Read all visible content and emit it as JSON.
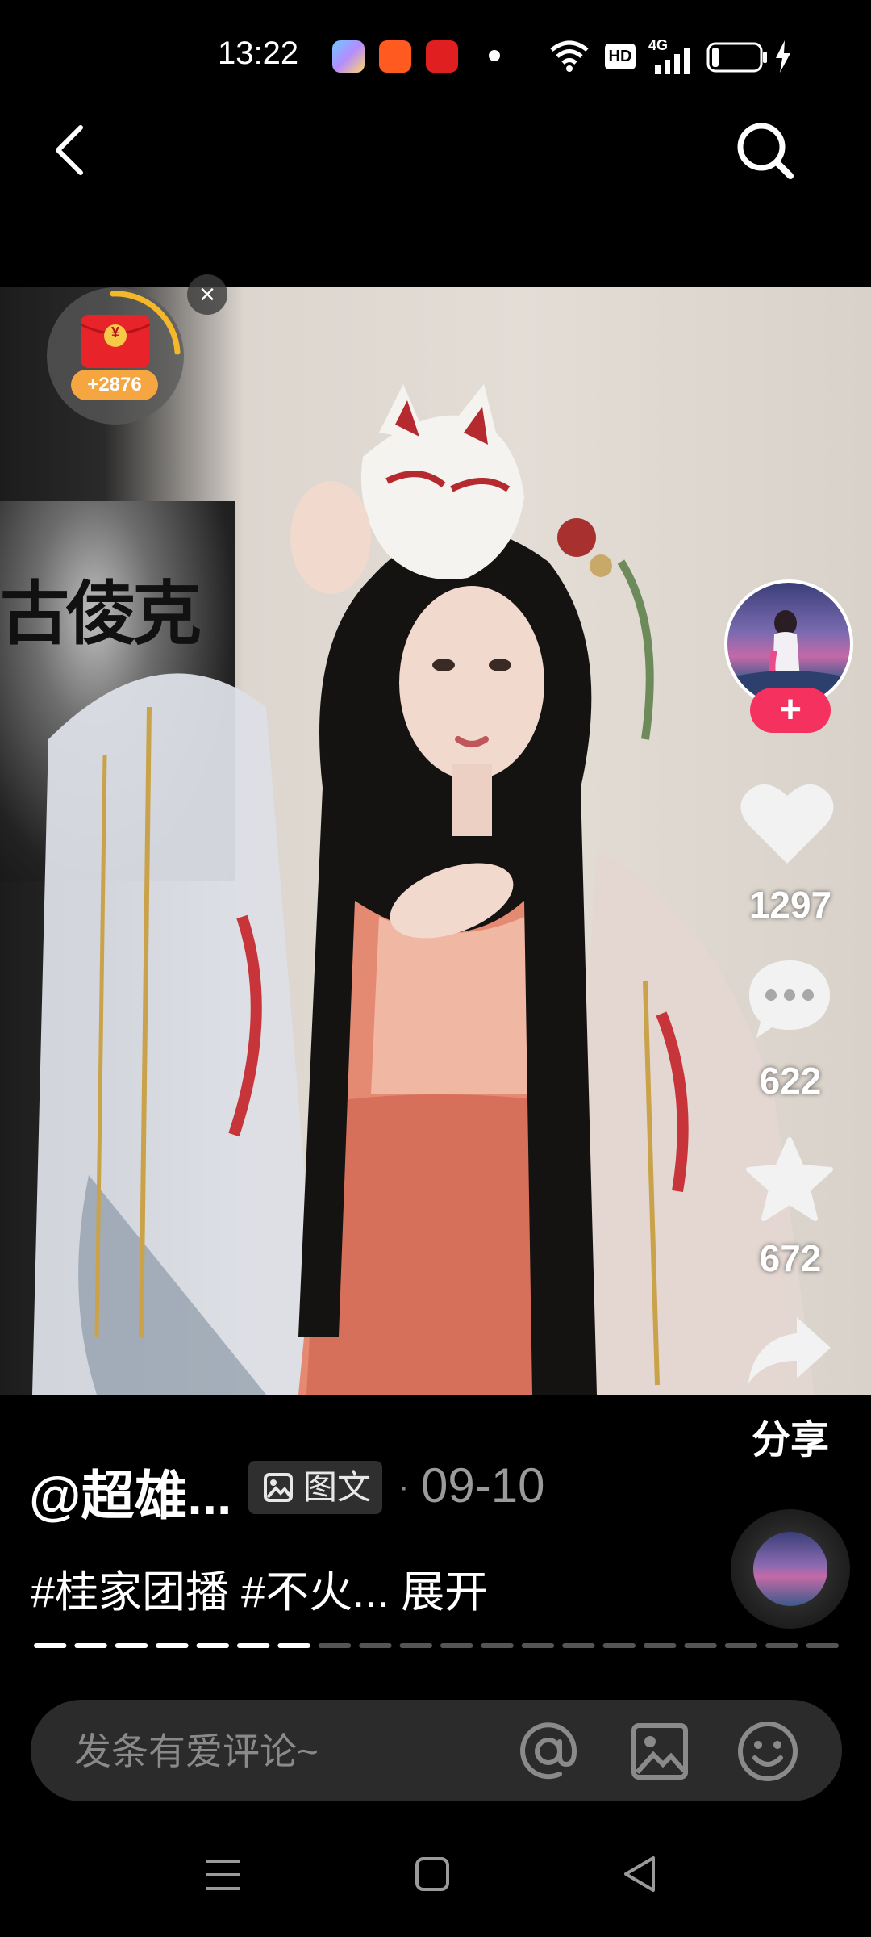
{
  "status_bar": {
    "time": "13:22",
    "network": "4G",
    "hd": "HD",
    "icons": [
      "gallery-app-icon",
      "game-center-icon",
      "shopping-app-icon",
      "dot-icon",
      "wifi-icon",
      "hd-icon",
      "signal-icon",
      "battery-icon",
      "charging-icon"
    ]
  },
  "nav": {
    "back_icon": "chevron-left-icon",
    "search_icon": "search-icon"
  },
  "media": {
    "poster_text": "古倰克",
    "redpacket": {
      "amount": "+2876",
      "close": "×",
      "currency_symbol": "¥"
    }
  },
  "rail": {
    "follow_label": "+",
    "like_count": "1297",
    "comment_count": "622",
    "favorite_count": "672",
    "share_label": "分享"
  },
  "post": {
    "author": "@超雄...",
    "badge": "图文",
    "separator": "·",
    "date": "09-10",
    "description": "#桂家团播 #不火... 展开"
  },
  "progress": {
    "segments_total": 20,
    "segments_viewed": 7
  },
  "comment": {
    "placeholder": "发条有爱评论~"
  },
  "colors": {
    "accent": "#f5325f",
    "redpacket": "#e8232a",
    "amount_pill": "#f5a640"
  }
}
